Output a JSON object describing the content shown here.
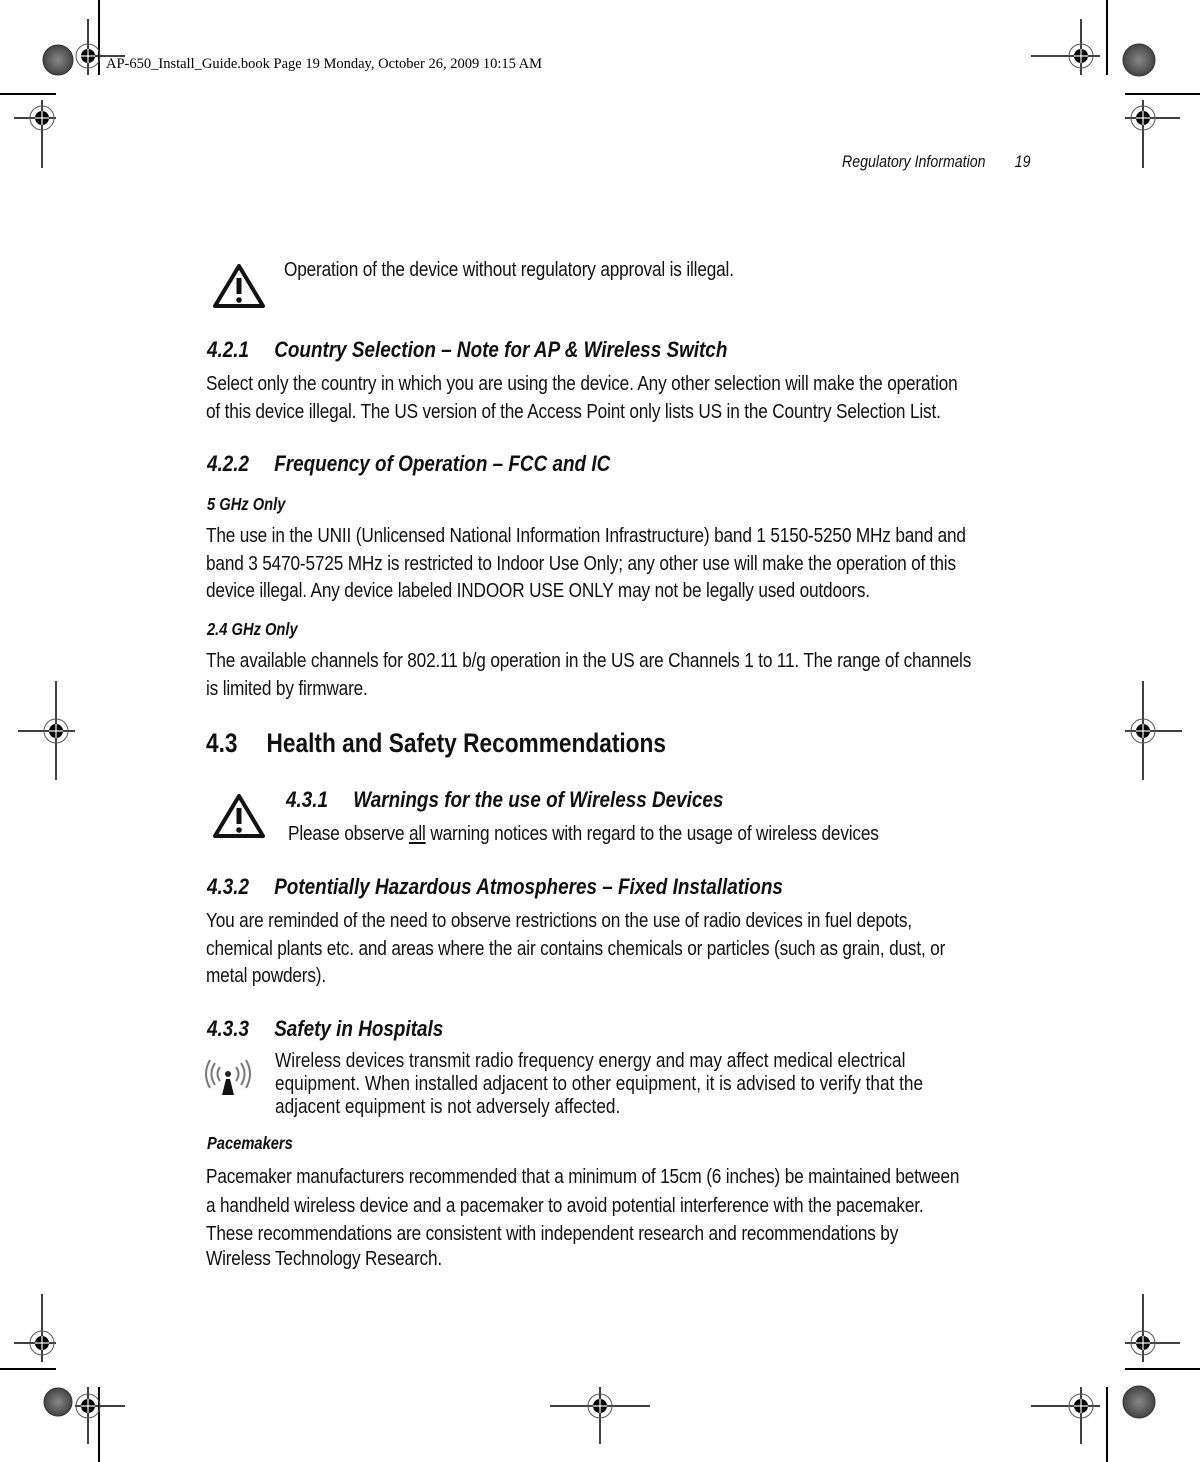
{
  "slug": "AP-650_Install_Guide.book  Page 19  Monday, October 26, 2009  10:15 AM",
  "running_head": {
    "title": "Regulatory Information",
    "page_number": "19"
  },
  "warning_note": {
    "icon": "warning-triangle-icon",
    "text": "Operation of the device without regulatory approval is illegal."
  },
  "sections": {
    "s421": {
      "number": "4.2.1",
      "title": "Country Selection – Note for AP & Wireless Switch",
      "lines": [
        "Select only the country in which you are using the device. Any other selection will make the operation",
        "of this device illegal.  The US version of the Access Point only lists US in the Country Selection List."
      ]
    },
    "s422": {
      "number": "4.2.2",
      "title": "Frequency of Operation – FCC and IC",
      "sub1": {
        "title": "5 GHz Only",
        "lines": [
          "The use in the UNII (Unlicensed National Information Infrastructure) band 1 5150-5250 MHz band and",
          "band 3 5470-5725 MHz is restricted to Indoor Use Only; any other use will make the operation of this",
          "device illegal. Any device labeled INDOOR USE ONLY may not be legally used outdoors."
        ]
      },
      "sub2": {
        "title": "2.4 GHz Only",
        "lines": [
          "The available channels for 802.11 b/g operation in the US are Channels 1 to 11. The range of channels",
          "is limited by firmware."
        ]
      }
    },
    "s43": {
      "number": "4.3",
      "title": "Health and Safety Recommendations"
    },
    "s431": {
      "number": "4.3.1",
      "title": "Warnings for the use of Wireless Devices",
      "icon": "warning-triangle-icon",
      "text_before": "Please observe ",
      "text_underlined": "all",
      "text_after": " warning notices with regard to the usage of wireless devices"
    },
    "s432": {
      "number": "4.3.2",
      "title": "Potentially Hazardous Atmospheres – Fixed Installations",
      "lines": [
        "You are reminded of the need to observe restrictions on the use of radio devices in fuel depots,",
        "chemical plants etc. and areas where the air contains chemicals or particles (such as grain, dust, or",
        "metal powders)."
      ]
    },
    "s433": {
      "number": "4.3.3",
      "title": "Safety in Hospitals",
      "icon": "radio-transmitter-icon",
      "note_lines": [
        "Wireless devices transmit radio frequency energy and may affect medical electrical",
        "equipment. When installed adjacent to other equipment, it is advised to verify that the",
        "adjacent equipment is not adversely affected."
      ],
      "pacemakers": {
        "title": "Pacemakers",
        "lines": [
          "Pacemaker manufacturers recommended that a minimum of 15cm (6 inches) be maintained between",
          "a handheld wireless device  and a pacemaker to avoid potential  interference with the pacemaker.",
          "These recommendations are consistent with independent research and recommendations by",
          "Wireless Technology Research."
        ]
      }
    }
  }
}
